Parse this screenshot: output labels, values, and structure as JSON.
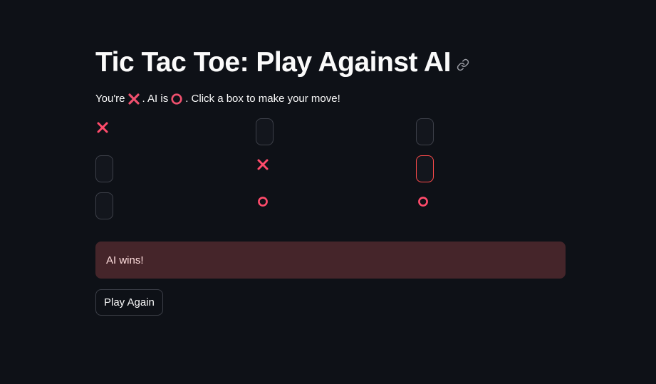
{
  "header": {
    "title": "Tic Tac Toe: Play Against AI",
    "link_icon": "link-icon"
  },
  "instructions": {
    "prefix": "You're",
    "player_symbol": "cross-mark-icon",
    "middle": ". AI is",
    "ai_symbol": "hollow-circle-icon",
    "suffix": ". Click a box to make your move!"
  },
  "board": [
    [
      "X",
      "",
      ""
    ],
    [
      "",
      "X",
      ""
    ],
    [
      "",
      "O",
      "O"
    ]
  ],
  "status": {
    "message": "AI wins!"
  },
  "actions": {
    "play_again_label": "Play Again"
  },
  "colors": {
    "background": "#0e1117",
    "accent": "#ff4b4b",
    "mark": "#ff4b6b",
    "error_bg": "#45252a"
  }
}
